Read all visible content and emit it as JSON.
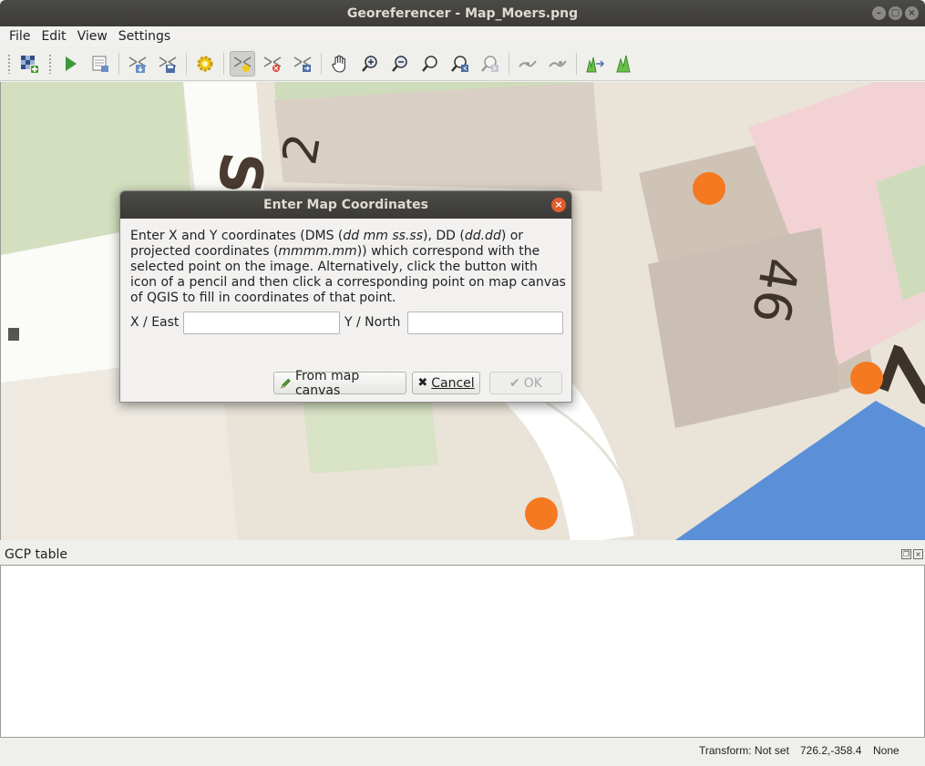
{
  "window": {
    "title": "Georeferencer - Map_Moers.png"
  },
  "menu": {
    "items": [
      "File",
      "Edit",
      "View",
      "Settings"
    ]
  },
  "dialog": {
    "title": "Enter Map Coordinates",
    "desc_1": "Enter X and Y coordinates (DMS (",
    "desc_dms": "dd mm ss.ss",
    "desc_2": "), DD (",
    "desc_dd": "dd.dd",
    "desc_3": ") or projected coordinates (",
    "desc_proj": "mmmm.mm",
    "desc_4": ")) which correspond with the selected point on the image. Alternatively, click the button with icon of a pencil and then click a corresponding point on map canvas of QGIS to fill in coordinates of that point.",
    "x_label": "X / East",
    "x_value": "",
    "y_label": "Y / North",
    "y_value": "",
    "btn_map_canvas": "From map canvas",
    "btn_cancel": "Cancel",
    "btn_ok": "OK"
  },
  "gcp": {
    "title": "GCP table"
  },
  "status": {
    "transform": "Transform: Not set",
    "coords": "726.2,-358.4",
    "crs": "None"
  },
  "map_labels": {
    "street": "Sf",
    "two": "2",
    "num": "46",
    "z": "Z"
  },
  "colors": {
    "accent": "#f47920",
    "water": "#5b8fd8",
    "dialog_close": "#e25c2c"
  }
}
